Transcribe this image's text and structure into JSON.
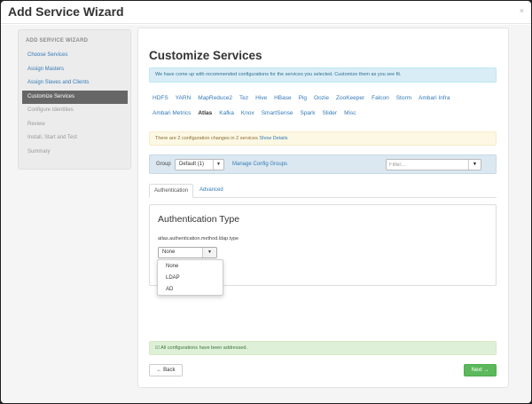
{
  "modal": {
    "title": "Add Service Wizard",
    "close_glyph": "×"
  },
  "sidebar": {
    "heading": "ADD SERVICE WIZARD",
    "steps": [
      {
        "label": "Choose Services",
        "state": "done"
      },
      {
        "label": "Assign Masters",
        "state": "done"
      },
      {
        "label": "Assign Slaves and Clients",
        "state": "done"
      },
      {
        "label": "Customize Services",
        "state": "active"
      },
      {
        "label": "Configure Identities",
        "state": "todo"
      },
      {
        "label": "Review",
        "state": "todo"
      },
      {
        "label": "Install, Start and Test",
        "state": "todo"
      },
      {
        "label": "Summary",
        "state": "todo"
      }
    ]
  },
  "main": {
    "title": "Customize Services",
    "info_message": "We have come up with recommended configurations for the services you selected. Customize them as you see fit.",
    "services_row1": [
      "HDFS",
      "YARN",
      "MapReduce2",
      "Tez",
      "Hive",
      "HBase",
      "Pig",
      "Oozie",
      "ZooKeeper",
      "Falcon",
      "Storm",
      "Ambari Infra"
    ],
    "services_row2": [
      "Ambari Metrics",
      "Atlas",
      "Kafka",
      "Knox",
      "SmartSense",
      "Spark",
      "Slider",
      "Misc"
    ],
    "active_service": "Atlas",
    "warning": {
      "text": "There are 2 configuration changes in 2 services",
      "link": "Show Details"
    },
    "group": {
      "label": "Group",
      "selected": "Default (1)",
      "manage_link": "Manage Config Groups",
      "filter_placeholder": "Filter..."
    },
    "tabs": [
      "Authentication",
      "Advanced"
    ],
    "auth": {
      "title": "Authentication Type",
      "property": "atlas.authentication.method.ldap.type",
      "selected": "None",
      "options": [
        "None",
        "LDAP",
        "AD"
      ]
    },
    "success_message": "All configurations have been addressed.",
    "back_button": "← Back",
    "next_button": "Next →"
  },
  "colors": {
    "accent": "#337ab7",
    "success": "#5cb85c",
    "info_bg": "#d9edf7",
    "warning_bg": "#fcf8e3",
    "active_step": "#666666"
  }
}
